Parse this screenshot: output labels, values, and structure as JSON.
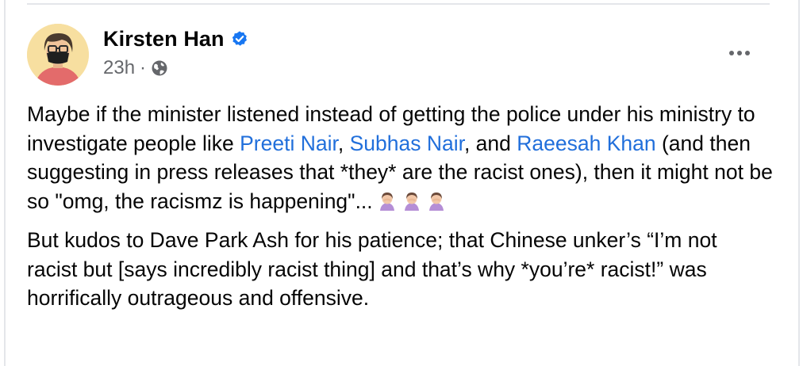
{
  "post": {
    "author": "Kirsten Han",
    "timestamp": "23h",
    "separator": "·",
    "verified": true,
    "privacy_icon": "globe-icon",
    "more_icon": "ellipsis-icon",
    "paragraph1": {
      "text_a": "Maybe if the minister listened instead of getting the police under his ministry to investigate people like ",
      "mention1": "Preeti Nair",
      "text_b": ", ",
      "mention2": "Subhas Nair",
      "text_c": ", and ",
      "mention3": "Raeesah Khan",
      "text_d": " (and then suggesting in press releases that *they* are the racist ones), then it might not be so \"omg, the racismz is happening\"...",
      "emoji": "woman-facepalming-icon",
      "emoji_count": 3
    },
    "paragraph2": "But kudos to Dave Park Ash for his patience; that Chinese unker’s “I’m not racist but [says incredibly racist thing] and that’s why *you’re* racist!” was horrifically outrageous and offensive."
  },
  "colors": {
    "text": "#050505",
    "secondary": "#65676b",
    "link": "#216fdb",
    "verified": "#1877f2",
    "avatar_bg": "#f7dfa0"
  }
}
